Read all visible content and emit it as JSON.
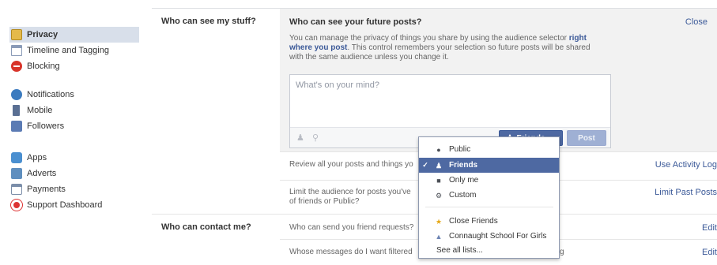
{
  "sidebar": {
    "group1": [
      {
        "label": "Privacy",
        "icon": "privacy-icon",
        "active": true
      },
      {
        "label": "Timeline and Tagging",
        "icon": "timeline-icon"
      },
      {
        "label": "Blocking",
        "icon": "blocking-icon"
      }
    ],
    "group2": [
      {
        "label": "Notifications",
        "icon": "globe-icon"
      },
      {
        "label": "Mobile",
        "icon": "mobile-icon"
      },
      {
        "label": "Followers",
        "icon": "followers-icon"
      }
    ],
    "group3": [
      {
        "label": "Apps",
        "icon": "apps-icon"
      },
      {
        "label": "Adverts",
        "icon": "adverts-icon"
      },
      {
        "label": "Payments",
        "icon": "payments-icon"
      },
      {
        "label": "Support Dashboard",
        "icon": "support-icon"
      }
    ]
  },
  "sections": {
    "stuff_label": "Who can see my stuff?",
    "contact_label": "Who can contact me?"
  },
  "expanded": {
    "title": "Who can see your future posts?",
    "close": "Close",
    "desc_before": "You can manage the privacy of things you share by using the audience selector ",
    "desc_link": "right where you post",
    "desc_after": ". This control remembers your selection so future posts will be shared with the same audience unless you change it.",
    "composer_placeholder": "What's on your mind?",
    "audience_label": "Friends",
    "post_label": "Post"
  },
  "rows": {
    "review_text": "Review all your posts and things yo",
    "review_action": "Use Activity Log",
    "limit_text_1": "Limit the audience for posts you've",
    "limit_text_2": "of friends or Public?",
    "limit_action": "Limit Past Posts",
    "friend_req_text": "Who can send you friend requests?",
    "friend_req_action": "Edit",
    "messages_text_1": "Whose messages do I want filtered",
    "messages_text_2": "g",
    "messages_action": "Edit"
  },
  "menu": {
    "items": [
      {
        "label": "Public",
        "icon": "globe-icon"
      },
      {
        "label": "Friends",
        "icon": "friends-icon",
        "selected": true
      },
      {
        "label": "Only me",
        "icon": "lock-icon"
      },
      {
        "label": "Custom",
        "icon": "gear-icon"
      },
      {
        "label": "Close Friends",
        "icon": "star-icon"
      },
      {
        "label": "Connaught School For Girls",
        "icon": "school-icon"
      },
      {
        "label": "See all lists..."
      }
    ]
  },
  "colors": {
    "accent": "#3b5998",
    "selected_bg": "#4e69a2",
    "panel_bg": "#f2f2f2"
  }
}
